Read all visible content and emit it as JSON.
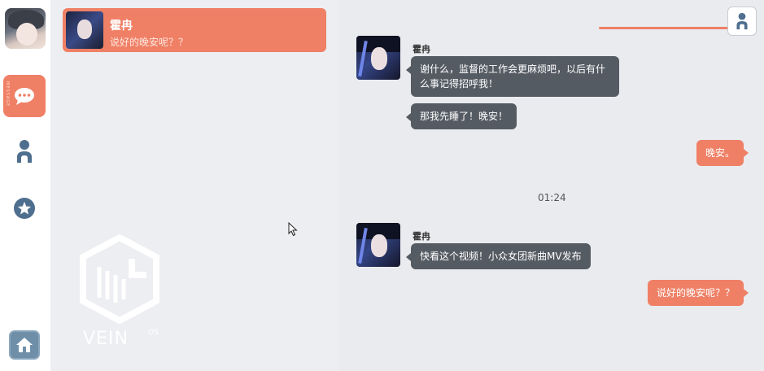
{
  "sidebar": {
    "messages_tag": "MESSAGE",
    "accent": "#ef8066",
    "items": [
      {
        "icon": "chat-bubble-icon",
        "active": true
      },
      {
        "icon": "person-icon",
        "active": false
      },
      {
        "icon": "star-icon",
        "active": false
      }
    ],
    "home_icon": "home-icon"
  },
  "conversations": [
    {
      "name": "霍冉",
      "preview": "说好的晚安呢？？"
    }
  ],
  "brand": {
    "logo_text": "VEIN",
    "logo_sub": "OS"
  },
  "chat": {
    "messages": [
      {
        "side": "in",
        "sender": "霍冉",
        "text": "谢什么，监督的工作会更麻烦吧，以后有什么事记得招呼我！"
      },
      {
        "side": "in",
        "sender": "",
        "text": "那我先睡了！晚安！"
      },
      {
        "side": "out",
        "text": "晚安。"
      },
      {
        "side": "time",
        "text": "01:24"
      },
      {
        "side": "in",
        "sender": "霍冉",
        "text": "快看这个视频！小众女团新曲MV发布"
      },
      {
        "side": "out",
        "text": "说好的晚安呢？？"
      }
    ]
  }
}
